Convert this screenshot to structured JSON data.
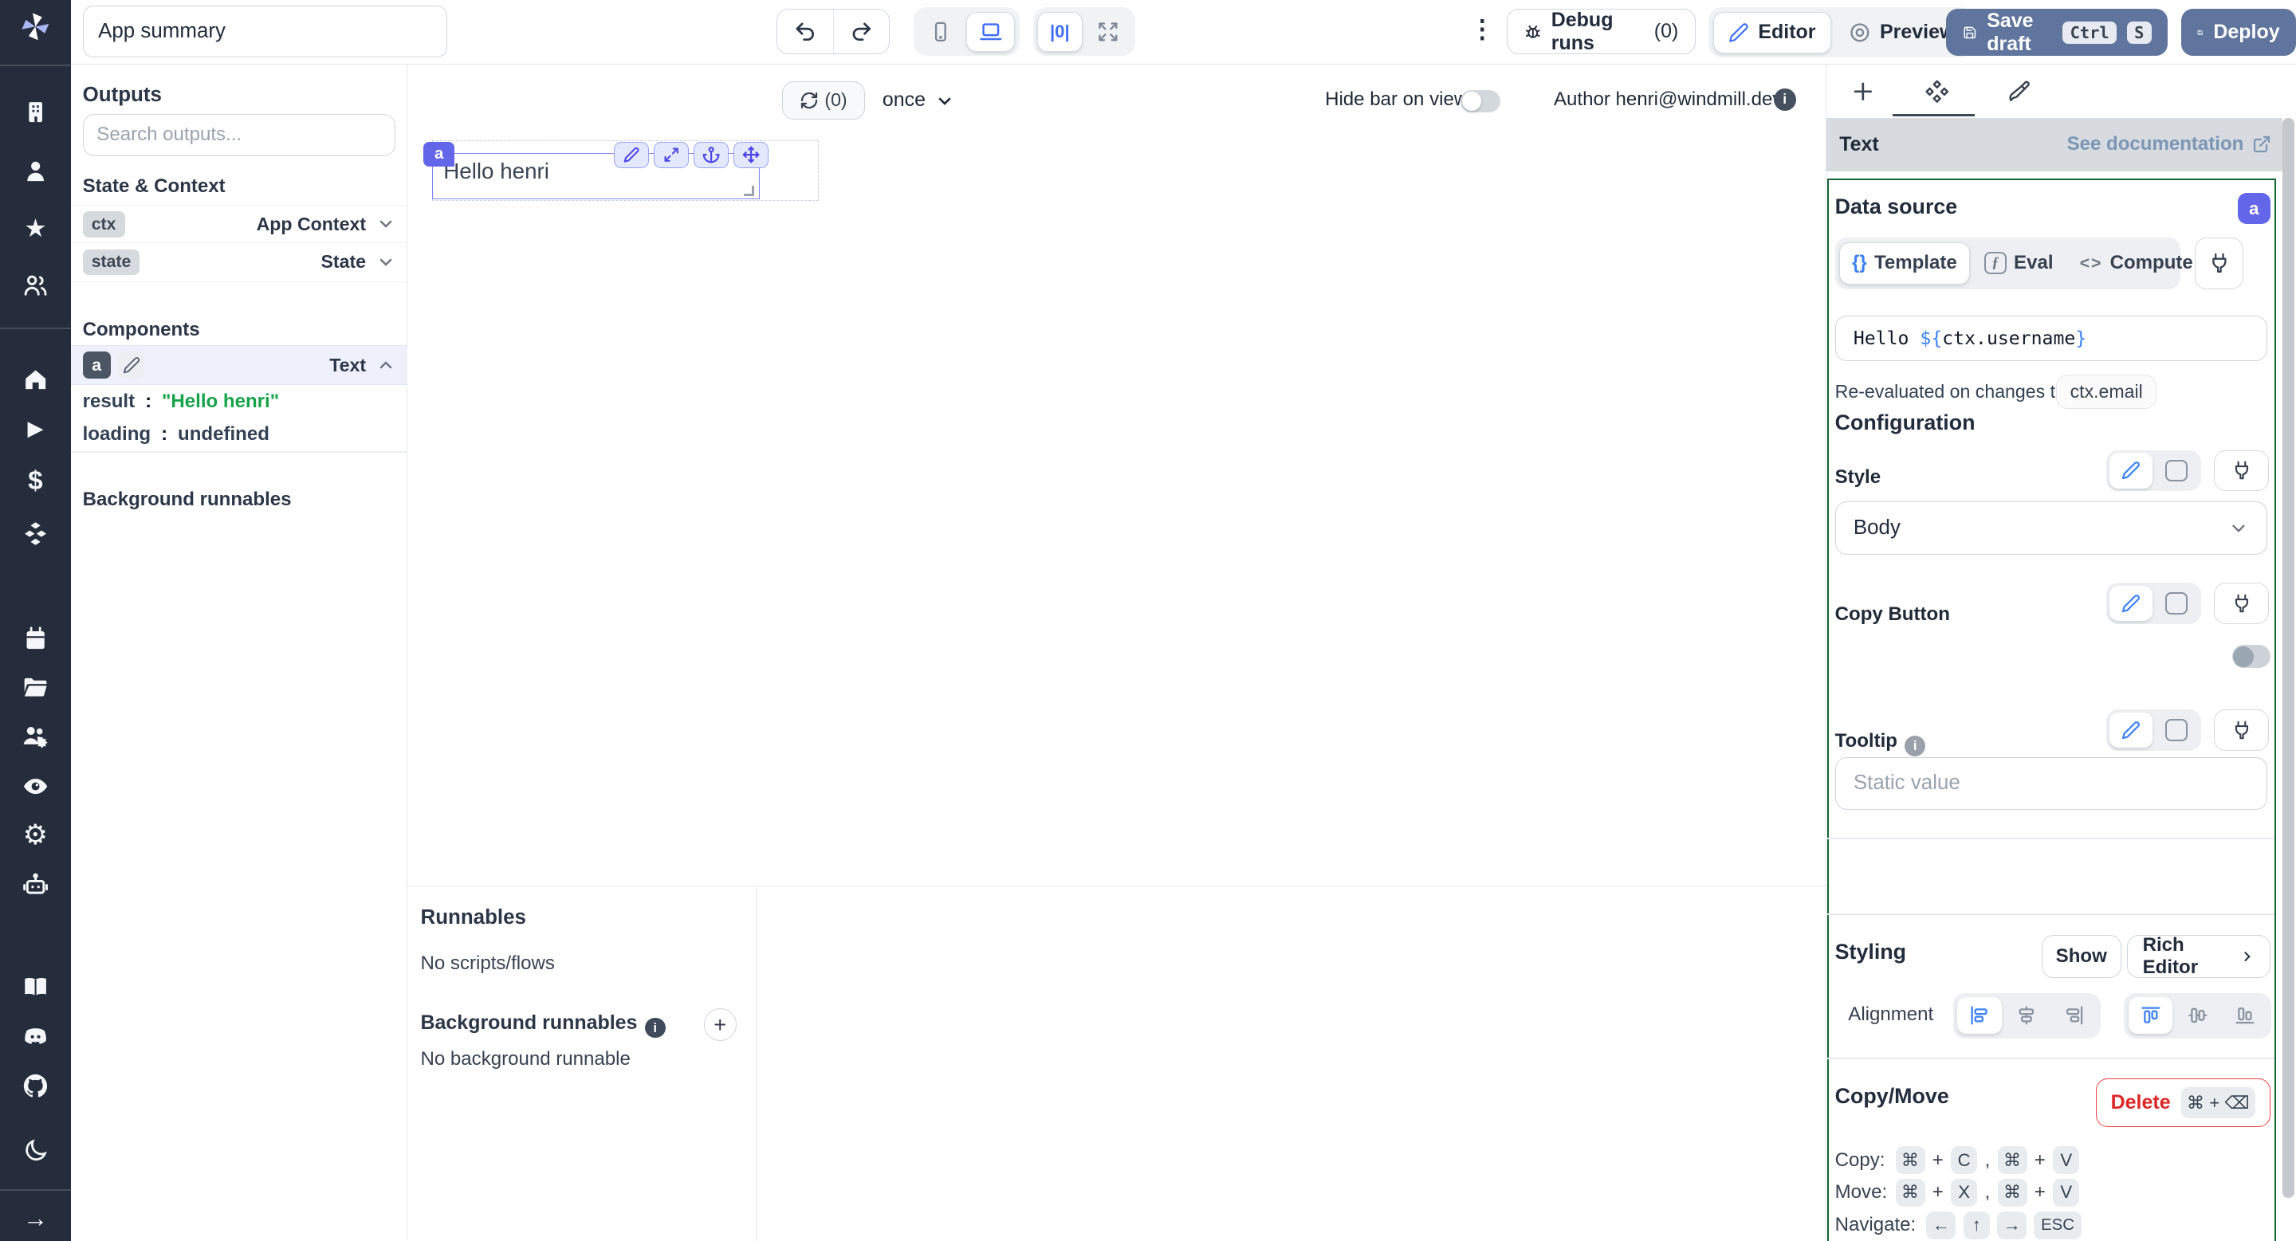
{
  "topbar": {
    "app_summary": "App summary",
    "debug_runs": "Debug runs",
    "debug_count": "(0)",
    "editor": "Editor",
    "preview": "Preview",
    "save_draft": "Save draft",
    "kbd_ctrl": "Ctrl",
    "kbd_s": "S",
    "deploy": "Deploy"
  },
  "outputs_panel": {
    "title": "Outputs",
    "search_placeholder": "Search outputs...",
    "state_context_title": "State & Context",
    "ctx_badge": "ctx",
    "ctx_label": "App Context",
    "state_badge": "state",
    "state_label": "State",
    "components_title": "Components",
    "component_badge": "a",
    "component_type": "Text",
    "result_key": "result",
    "colon": ":",
    "result_value": "\"Hello henri\"",
    "loading_key": "loading",
    "loading_value": "undefined",
    "background_title": "Background runnables"
  },
  "canvas_bar": {
    "refresh_count": "(0)",
    "schedule": "once",
    "hide_bar_label": "Hide bar on view",
    "author": "Author henri@windmill.dev"
  },
  "canvas": {
    "component_badge": "a",
    "component_text": "Hello henri"
  },
  "runnables_panel": {
    "title": "Runnables",
    "empty": "No scripts/flows",
    "background_title": "Background runnables",
    "background_empty": "No background runnable"
  },
  "settings_panel": {
    "header_title": "Text",
    "see_documentation": "See documentation",
    "data_source": {
      "title": "Data source",
      "badge": "a",
      "template_glyph": "{}",
      "template": "Template",
      "eval_glyph": "ƒ",
      "eval": "Eval",
      "compute_glyph": "<>",
      "compute": "Compute",
      "code_prefix": "Hello ",
      "code_open": "${",
      "code_expr": "ctx.username",
      "code_close": "}",
      "reeval_label": "Re-evaluated on changes to:",
      "reeval_dep": "ctx.email"
    },
    "configuration": {
      "title": "Configuration",
      "style_label": "Style",
      "style_value": "Body",
      "copy_button_label": "Copy Button",
      "tooltip_label": "Tooltip",
      "tooltip_placeholder": "Static value"
    },
    "styling": {
      "title": "Styling",
      "show": "Show",
      "rich_editor": "Rich Editor",
      "alignment_label": "Alignment"
    },
    "copy_move": {
      "title": "Copy/Move",
      "delete": "Delete",
      "delete_kbd": "⌘ + ⌫",
      "copy_label": "Copy:",
      "move_label": "Move:",
      "navigate_label": "Navigate:",
      "cmd": "⌘",
      "plus": "+",
      "comma": ",",
      "key_c": "C",
      "key_v": "V",
      "key_x": "X",
      "arrow_left": "←",
      "arrow_up": "↑",
      "arrow_right": "→",
      "esc": "ESC"
    }
  },
  "icons": {
    "star": "★",
    "play": "▶",
    "dollar": "$",
    "gear": "⚙",
    "arrow_right": "→",
    "kebab": "⋮",
    "plus": "+",
    "center_io": "|0|",
    "info_i": "i"
  },
  "colors": {
    "accent_indigo": "#6466e9",
    "steel_button": "#60759d",
    "result_green": "#16a34a",
    "delete_red": "#dc2626",
    "selection_green_border": "#166534",
    "sidebar_bg": "#252c3b"
  }
}
